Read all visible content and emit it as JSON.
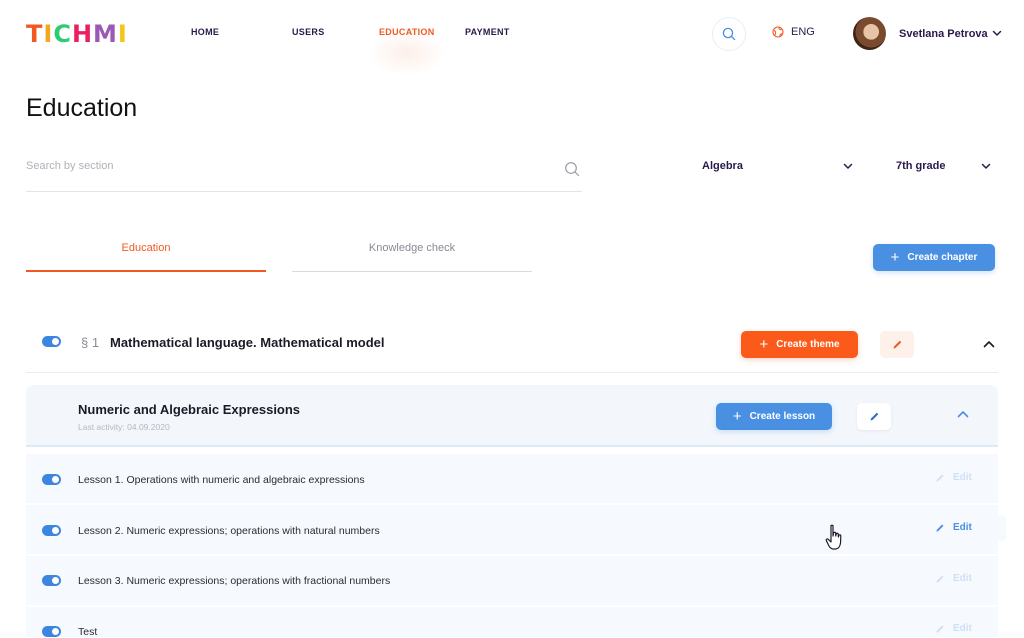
{
  "brand": {
    "letters": [
      {
        "ch": "T",
        "color": "#f05a22"
      },
      {
        "ch": "I",
        "color": "#f5a623"
      },
      {
        "ch": "C",
        "color": "#2ecc71"
      },
      {
        "ch": "H",
        "color": "#e91e63"
      },
      {
        "ch": "M",
        "color": "#9b59b6"
      },
      {
        "ch": "I",
        "color": "#f5c518"
      }
    ]
  },
  "nav": {
    "items": [
      {
        "label": "HOME"
      },
      {
        "label": "USERS"
      },
      {
        "label": "EDUCATION",
        "active": true
      },
      {
        "label": "PAYMENT"
      }
    ]
  },
  "header": {
    "language": "ENG",
    "user_name": "Svetlana Petrova"
  },
  "page": {
    "title": "Education"
  },
  "filters": {
    "search_placeholder": "Search by section",
    "subject": "Algebra",
    "grade": "7th grade"
  },
  "tabs": [
    {
      "label": "Education",
      "active": true
    },
    {
      "label": "Knowledge check",
      "active": false
    }
  ],
  "buttons": {
    "create_chapter": "Create chapter",
    "create_theme": "Create theme",
    "create_lesson": "Create lesson"
  },
  "chapter": {
    "number": "§ 1",
    "title": "Mathematical language. Mathematical model",
    "enabled": true
  },
  "theme": {
    "title": "Numeric and Algebraic Expressions",
    "last_activity": "Last activity: 04.09.2020"
  },
  "lessons": [
    {
      "title": "Lesson 1. Operations with numeric and algebraic expressions",
      "edit": "Edit",
      "enabled": true
    },
    {
      "title": "Lesson 2. Numeric expressions; operations with natural numbers",
      "edit": "Edit",
      "enabled": true,
      "hovered": true
    },
    {
      "title": "Lesson 3. Numeric expressions; operations with fractional numbers",
      "edit": "Edit",
      "enabled": true
    },
    {
      "title": "Test",
      "edit": "Edit",
      "enabled": true
    }
  ],
  "colors": {
    "accent_orange": "#f05a22",
    "accent_blue": "#4a90e2",
    "nav_text": "#2a1a4a"
  }
}
